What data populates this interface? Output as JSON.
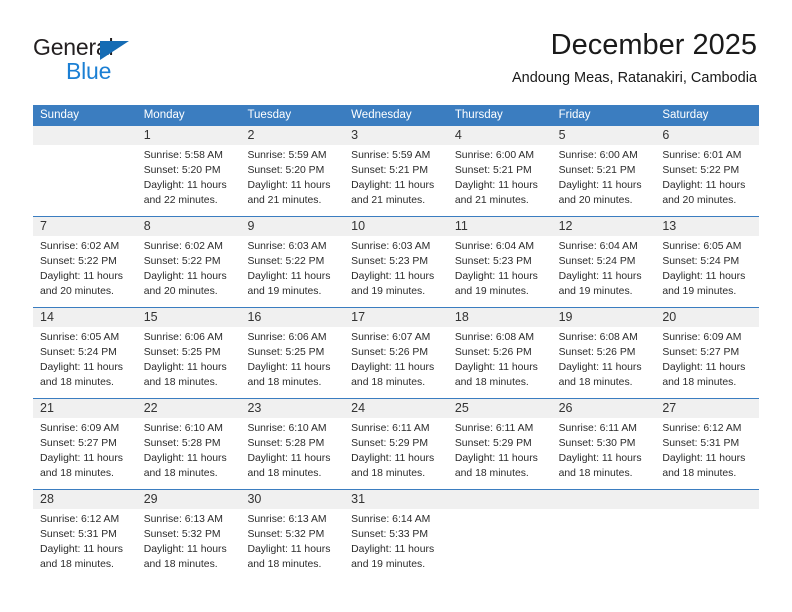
{
  "brand": {
    "name_part1": "General",
    "name_part2": "Blue",
    "triangle_color": "#156cb4",
    "blue_text_color": "#1b7fd4"
  },
  "header": {
    "title": "December 2025",
    "subtitle": "Andoung Meas, Ratanakiri, Cambodia"
  },
  "theme": {
    "header_blue": "#3b7dc0",
    "numrow_gray": "#f0f0f0"
  },
  "weekdays": [
    "Sunday",
    "Monday",
    "Tuesday",
    "Wednesday",
    "Thursday",
    "Friday",
    "Saturday"
  ],
  "labels": {
    "sunrise": "Sunrise:",
    "sunset": "Sunset:",
    "daylight": "Daylight:"
  },
  "weeks": [
    [
      {
        "day": "",
        "sunrise": "",
        "sunset": "",
        "daylight_line1": "",
        "daylight_line2": ""
      },
      {
        "day": "1",
        "sunrise": "Sunrise: 5:58 AM",
        "sunset": "Sunset: 5:20 PM",
        "daylight_line1": "Daylight: 11 hours",
        "daylight_line2": "and 22 minutes."
      },
      {
        "day": "2",
        "sunrise": "Sunrise: 5:59 AM",
        "sunset": "Sunset: 5:20 PM",
        "daylight_line1": "Daylight: 11 hours",
        "daylight_line2": "and 21 minutes."
      },
      {
        "day": "3",
        "sunrise": "Sunrise: 5:59 AM",
        "sunset": "Sunset: 5:21 PM",
        "daylight_line1": "Daylight: 11 hours",
        "daylight_line2": "and 21 minutes."
      },
      {
        "day": "4",
        "sunrise": "Sunrise: 6:00 AM",
        "sunset": "Sunset: 5:21 PM",
        "daylight_line1": "Daylight: 11 hours",
        "daylight_line2": "and 21 minutes."
      },
      {
        "day": "5",
        "sunrise": "Sunrise: 6:00 AM",
        "sunset": "Sunset: 5:21 PM",
        "daylight_line1": "Daylight: 11 hours",
        "daylight_line2": "and 20 minutes."
      },
      {
        "day": "6",
        "sunrise": "Sunrise: 6:01 AM",
        "sunset": "Sunset: 5:22 PM",
        "daylight_line1": "Daylight: 11 hours",
        "daylight_line2": "and 20 minutes."
      }
    ],
    [
      {
        "day": "7",
        "sunrise": "Sunrise: 6:02 AM",
        "sunset": "Sunset: 5:22 PM",
        "daylight_line1": "Daylight: 11 hours",
        "daylight_line2": "and 20 minutes."
      },
      {
        "day": "8",
        "sunrise": "Sunrise: 6:02 AM",
        "sunset": "Sunset: 5:22 PM",
        "daylight_line1": "Daylight: 11 hours",
        "daylight_line2": "and 20 minutes."
      },
      {
        "day": "9",
        "sunrise": "Sunrise: 6:03 AM",
        "sunset": "Sunset: 5:22 PM",
        "daylight_line1": "Daylight: 11 hours",
        "daylight_line2": "and 19 minutes."
      },
      {
        "day": "10",
        "sunrise": "Sunrise: 6:03 AM",
        "sunset": "Sunset: 5:23 PM",
        "daylight_line1": "Daylight: 11 hours",
        "daylight_line2": "and 19 minutes."
      },
      {
        "day": "11",
        "sunrise": "Sunrise: 6:04 AM",
        "sunset": "Sunset: 5:23 PM",
        "daylight_line1": "Daylight: 11 hours",
        "daylight_line2": "and 19 minutes."
      },
      {
        "day": "12",
        "sunrise": "Sunrise: 6:04 AM",
        "sunset": "Sunset: 5:24 PM",
        "daylight_line1": "Daylight: 11 hours",
        "daylight_line2": "and 19 minutes."
      },
      {
        "day": "13",
        "sunrise": "Sunrise: 6:05 AM",
        "sunset": "Sunset: 5:24 PM",
        "daylight_line1": "Daylight: 11 hours",
        "daylight_line2": "and 19 minutes."
      }
    ],
    [
      {
        "day": "14",
        "sunrise": "Sunrise: 6:05 AM",
        "sunset": "Sunset: 5:24 PM",
        "daylight_line1": "Daylight: 11 hours",
        "daylight_line2": "and 18 minutes."
      },
      {
        "day": "15",
        "sunrise": "Sunrise: 6:06 AM",
        "sunset": "Sunset: 5:25 PM",
        "daylight_line1": "Daylight: 11 hours",
        "daylight_line2": "and 18 minutes."
      },
      {
        "day": "16",
        "sunrise": "Sunrise: 6:06 AM",
        "sunset": "Sunset: 5:25 PM",
        "daylight_line1": "Daylight: 11 hours",
        "daylight_line2": "and 18 minutes."
      },
      {
        "day": "17",
        "sunrise": "Sunrise: 6:07 AM",
        "sunset": "Sunset: 5:26 PM",
        "daylight_line1": "Daylight: 11 hours",
        "daylight_line2": "and 18 minutes."
      },
      {
        "day": "18",
        "sunrise": "Sunrise: 6:08 AM",
        "sunset": "Sunset: 5:26 PM",
        "daylight_line1": "Daylight: 11 hours",
        "daylight_line2": "and 18 minutes."
      },
      {
        "day": "19",
        "sunrise": "Sunrise: 6:08 AM",
        "sunset": "Sunset: 5:26 PM",
        "daylight_line1": "Daylight: 11 hours",
        "daylight_line2": "and 18 minutes."
      },
      {
        "day": "20",
        "sunrise": "Sunrise: 6:09 AM",
        "sunset": "Sunset: 5:27 PM",
        "daylight_line1": "Daylight: 11 hours",
        "daylight_line2": "and 18 minutes."
      }
    ],
    [
      {
        "day": "21",
        "sunrise": "Sunrise: 6:09 AM",
        "sunset": "Sunset: 5:27 PM",
        "daylight_line1": "Daylight: 11 hours",
        "daylight_line2": "and 18 minutes."
      },
      {
        "day": "22",
        "sunrise": "Sunrise: 6:10 AM",
        "sunset": "Sunset: 5:28 PM",
        "daylight_line1": "Daylight: 11 hours",
        "daylight_line2": "and 18 minutes."
      },
      {
        "day": "23",
        "sunrise": "Sunrise: 6:10 AM",
        "sunset": "Sunset: 5:28 PM",
        "daylight_line1": "Daylight: 11 hours",
        "daylight_line2": "and 18 minutes."
      },
      {
        "day": "24",
        "sunrise": "Sunrise: 6:11 AM",
        "sunset": "Sunset: 5:29 PM",
        "daylight_line1": "Daylight: 11 hours",
        "daylight_line2": "and 18 minutes."
      },
      {
        "day": "25",
        "sunrise": "Sunrise: 6:11 AM",
        "sunset": "Sunset: 5:29 PM",
        "daylight_line1": "Daylight: 11 hours",
        "daylight_line2": "and 18 minutes."
      },
      {
        "day": "26",
        "sunrise": "Sunrise: 6:11 AM",
        "sunset": "Sunset: 5:30 PM",
        "daylight_line1": "Daylight: 11 hours",
        "daylight_line2": "and 18 minutes."
      },
      {
        "day": "27",
        "sunrise": "Sunrise: 6:12 AM",
        "sunset": "Sunset: 5:31 PM",
        "daylight_line1": "Daylight: 11 hours",
        "daylight_line2": "and 18 minutes."
      }
    ],
    [
      {
        "day": "28",
        "sunrise": "Sunrise: 6:12 AM",
        "sunset": "Sunset: 5:31 PM",
        "daylight_line1": "Daylight: 11 hours",
        "daylight_line2": "and 18 minutes."
      },
      {
        "day": "29",
        "sunrise": "Sunrise: 6:13 AM",
        "sunset": "Sunset: 5:32 PM",
        "daylight_line1": "Daylight: 11 hours",
        "daylight_line2": "and 18 minutes."
      },
      {
        "day": "30",
        "sunrise": "Sunrise: 6:13 AM",
        "sunset": "Sunset: 5:32 PM",
        "daylight_line1": "Daylight: 11 hours",
        "daylight_line2": "and 18 minutes."
      },
      {
        "day": "31",
        "sunrise": "Sunrise: 6:14 AM",
        "sunset": "Sunset: 5:33 PM",
        "daylight_line1": "Daylight: 11 hours",
        "daylight_line2": "and 19 minutes."
      },
      {
        "day": "",
        "sunrise": "",
        "sunset": "",
        "daylight_line1": "",
        "daylight_line2": ""
      },
      {
        "day": "",
        "sunrise": "",
        "sunset": "",
        "daylight_line1": "",
        "daylight_line2": ""
      },
      {
        "day": "",
        "sunrise": "",
        "sunset": "",
        "daylight_line1": "",
        "daylight_line2": ""
      }
    ]
  ]
}
